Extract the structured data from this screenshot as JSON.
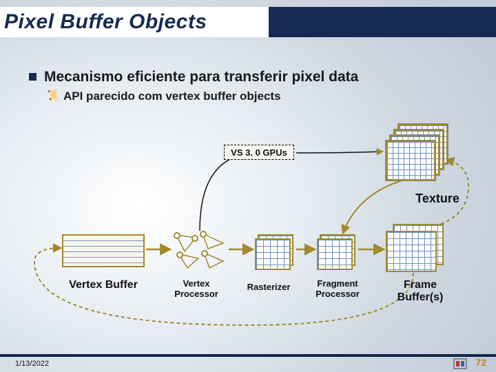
{
  "title": "Pixel Buffer Objects",
  "bullets": {
    "level1": "Mecanismo eficiente para transferir pixel data",
    "level2": "API parecido com vertex buffer objects"
  },
  "diagram": {
    "vs_box": "VS 3. 0 GPUs",
    "texture_label": "Texture",
    "stages": {
      "vertex_buffer": "Vertex Buffer",
      "vertex_processor": "Vertex\nProcessor",
      "rasterizer": "Rasterizer",
      "fragment_processor": "Fragment\nProcessor",
      "frame_buffers": "Frame\nBuffer(s)"
    }
  },
  "footer": {
    "date": "1/13/2022",
    "page_number": "72"
  },
  "colors": {
    "title_navy": "#142a52",
    "accent_olive": "#a08a2a",
    "grid_blue": "#6d8fc2",
    "page_gold": "#b7881c"
  }
}
